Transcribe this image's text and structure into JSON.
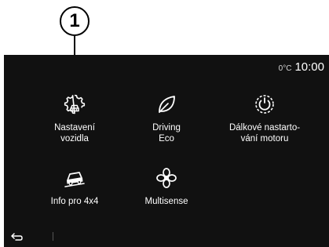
{
  "callout": {
    "number": "1"
  },
  "status": {
    "temperature": "0°C",
    "time": "10:00"
  },
  "apps": [
    {
      "label": "Nastavení\nvozidla",
      "icon": "vehicle-settings-gear-icon"
    },
    {
      "label": "Driving\nEco",
      "icon": "eco-leaf-icon"
    },
    {
      "label": "Dálkové nastarto-\nvání motoru",
      "icon": "remote-engine-start-icon"
    },
    {
      "label": "Info pro 4x4",
      "icon": "4x4-offroad-vehicle-icon"
    },
    {
      "label": "Multisense",
      "icon": "multisense-flower-icon"
    }
  ],
  "nav": {
    "back_icon": "back-arrow-icon"
  }
}
